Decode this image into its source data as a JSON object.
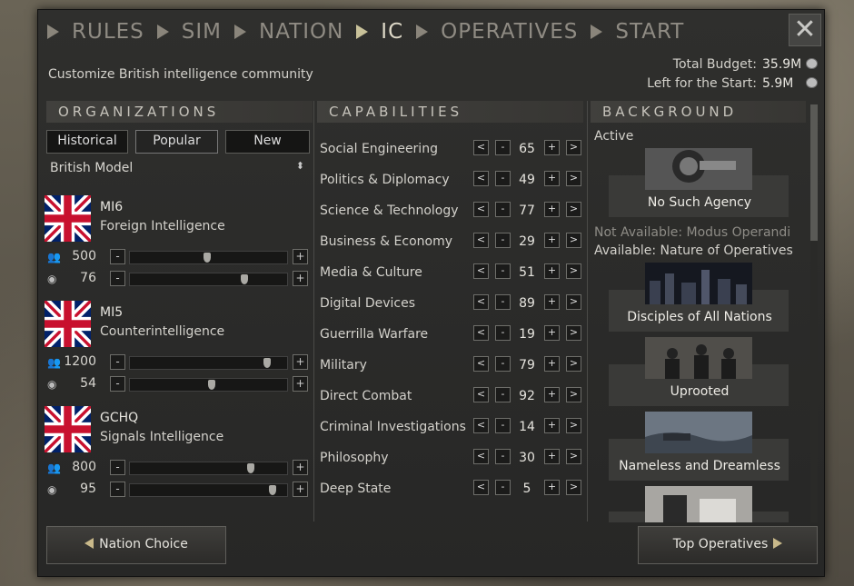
{
  "steps": [
    "RULES",
    "SIM",
    "NATION",
    "IC",
    "OPERATIVES",
    "START"
  ],
  "subtitle": "Customize British intelligence community",
  "budget": {
    "total_label": "Total Budget:",
    "total_value": "35.9M",
    "start_label": "Left for the Start:",
    "start_value": "5.9M"
  },
  "organizations": {
    "header": "ORGANIZATIONS",
    "tabs": [
      "Historical",
      "Popular",
      "New"
    ],
    "model": "British Model",
    "list": [
      {
        "name": "MI6",
        "type": "Foreign Intelligence",
        "staff": "500",
        "staff_level": 0.49,
        "skill": "76",
        "skill_level": 0.73
      },
      {
        "name": "MI5",
        "type": "Counterintelligence",
        "staff": "1200",
        "staff_level": 0.87,
        "skill": "54",
        "skill_level": 0.52
      },
      {
        "name": "GCHQ",
        "type": "Signals Intelligence",
        "staff": "800",
        "staff_level": 0.77,
        "skill": "95",
        "skill_level": 0.91
      }
    ]
  },
  "capabilities": {
    "header": "CAPABILITIES",
    "list": [
      {
        "name": "Social Engineering",
        "value": "65"
      },
      {
        "name": "Politics & Diplomacy",
        "value": "49"
      },
      {
        "name": "Science & Technology",
        "value": "77"
      },
      {
        "name": "Business & Economy",
        "value": "29"
      },
      {
        "name": "Media & Culture",
        "value": "51"
      },
      {
        "name": "Digital Devices",
        "value": "89"
      },
      {
        "name": "Guerrilla Warfare",
        "value": "19"
      },
      {
        "name": "Military",
        "value": "79"
      },
      {
        "name": "Direct Combat",
        "value": "92"
      },
      {
        "name": "Criminal  Investigations",
        "value": "14"
      },
      {
        "name": "Philosophy",
        "value": "30"
      },
      {
        "name": "Deep State",
        "value": "5"
      }
    ]
  },
  "background": {
    "header": "BACKGROUND",
    "active_label": "Active",
    "not_available": "Not Available: Modus Operandi",
    "available": "Available: Nature of Operatives",
    "cards": [
      "No Such Agency",
      "Disciples of All Nations",
      "Uprooted",
      "Nameless and Dreamless"
    ]
  },
  "nav": {
    "back": "Nation Choice",
    "next": "Top Operatives"
  },
  "colors": {
    "accent": "#c9c29a",
    "panel": "#2f2f2d"
  }
}
